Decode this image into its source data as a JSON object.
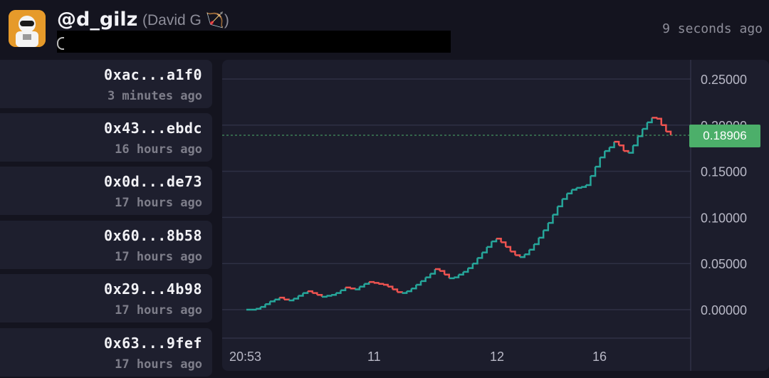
{
  "header": {
    "handle": "@d_gilz",
    "display_name": "(David G 🏹)",
    "timestamp": "9 seconds ago"
  },
  "transactions": [
    {
      "address": "0xac...a1f0",
      "time": "3 minutes ago"
    },
    {
      "address": "0x43...ebdc",
      "time": "16 hours ago"
    },
    {
      "address": "0x0d...de73",
      "time": "17 hours ago"
    },
    {
      "address": "0x60...8b58",
      "time": "17 hours ago"
    },
    {
      "address": "0x29...4b98",
      "time": "17 hours ago"
    },
    {
      "address": "0x63...9fef",
      "time": "17 hours ago"
    }
  ],
  "colors": {
    "up": "#26a69a",
    "down": "#ef5350",
    "price_tag": "#4caf6a",
    "grid": "#2e3044"
  },
  "chart_data": {
    "type": "line",
    "y_ticks": [
      "0.25000",
      "0.20000",
      "0.15000",
      "0.10000",
      "0.05000",
      "0.00000"
    ],
    "y_tick_values": [
      0.25,
      0.2,
      0.15,
      0.1,
      0.05,
      0.0
    ],
    "ylim": [
      -0.03,
      0.27
    ],
    "x_ticks": [
      "20:53",
      "11",
      "12",
      "16"
    ],
    "current_price": 0.18906,
    "current_price_label": "0.18906",
    "grid": true,
    "values": [
      0.0,
      0.0,
      0.001,
      0.003,
      0.006,
      0.009,
      0.011,
      0.013,
      0.011,
      0.01,
      0.012,
      0.015,
      0.018,
      0.02,
      0.018,
      0.016,
      0.014,
      0.015,
      0.016,
      0.018,
      0.021,
      0.024,
      0.023,
      0.022,
      0.025,
      0.028,
      0.03,
      0.029,
      0.028,
      0.027,
      0.025,
      0.022,
      0.019,
      0.018,
      0.02,
      0.023,
      0.027,
      0.031,
      0.035,
      0.039,
      0.044,
      0.042,
      0.038,
      0.034,
      0.035,
      0.038,
      0.041,
      0.045,
      0.05,
      0.056,
      0.062,
      0.068,
      0.074,
      0.077,
      0.073,
      0.068,
      0.063,
      0.059,
      0.057,
      0.06,
      0.065,
      0.071,
      0.078,
      0.086,
      0.094,
      0.103,
      0.112,
      0.12,
      0.126,
      0.13,
      0.132,
      0.133,
      0.135,
      0.145,
      0.155,
      0.165,
      0.172,
      0.176,
      0.182,
      0.178,
      0.172,
      0.17,
      0.178,
      0.188,
      0.196,
      0.203,
      0.208,
      0.207,
      0.2,
      0.193,
      0.189
    ]
  }
}
